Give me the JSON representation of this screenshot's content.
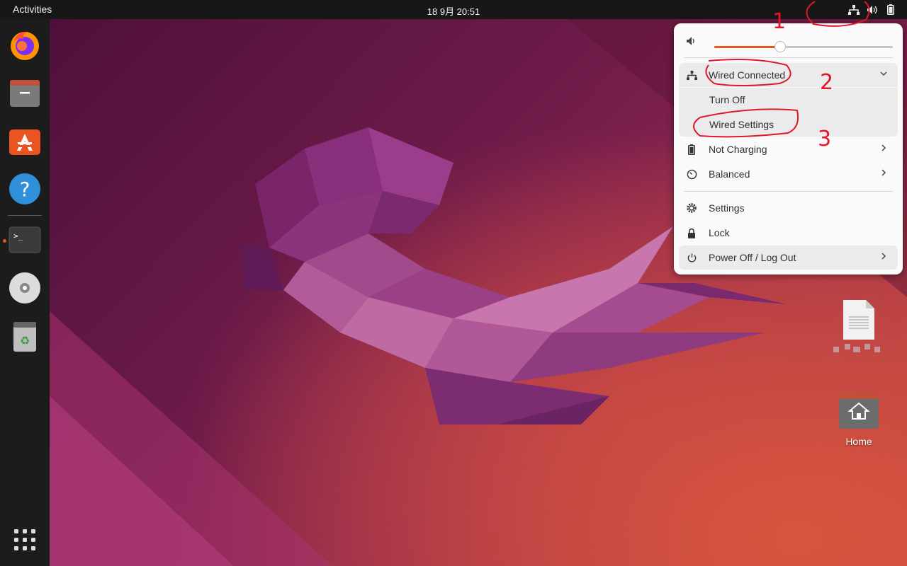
{
  "topbar": {
    "activities_label": "Activities",
    "clock": "18 9月  20:51",
    "tray_icons": [
      "network-wired-icon",
      "volume-icon",
      "battery-icon"
    ]
  },
  "dock": {
    "items": [
      {
        "name": "firefox",
        "icon": "firefox-icon"
      },
      {
        "name": "files",
        "icon": "files-icon"
      },
      {
        "name": "app-center",
        "icon": "app-center-icon"
      },
      {
        "name": "help",
        "icon": "help-icon"
      },
      {
        "name": "terminal",
        "icon": "terminal-icon",
        "running": true
      },
      {
        "name": "disc",
        "icon": "disc-icon"
      },
      {
        "name": "trash",
        "icon": "trash-icon"
      }
    ],
    "show_apps_icon": "app-grid-icon"
  },
  "system_menu": {
    "volume_percent": 37,
    "network": {
      "label": "Wired Connected",
      "expanded": true,
      "submenu": [
        "Turn Off",
        "Wired Settings"
      ]
    },
    "battery_label": "Not Charging",
    "power_mode_label": "Balanced",
    "settings_label": "Settings",
    "lock_label": "Lock",
    "power_label": "Power Off / Log Out"
  },
  "annotations": [
    "1",
    "2",
    "3"
  ],
  "desktop": {
    "icons": [
      {
        "label": "",
        "icon": "text-file-icon"
      },
      {
        "label": "Home",
        "icon": "home-folder-icon"
      }
    ]
  },
  "colors": {
    "accent": "#e95420",
    "annotation": "#e0182a",
    "topbar": "#171717",
    "dock": "#1c1c1c",
    "menu_bg": "#fafafa"
  }
}
